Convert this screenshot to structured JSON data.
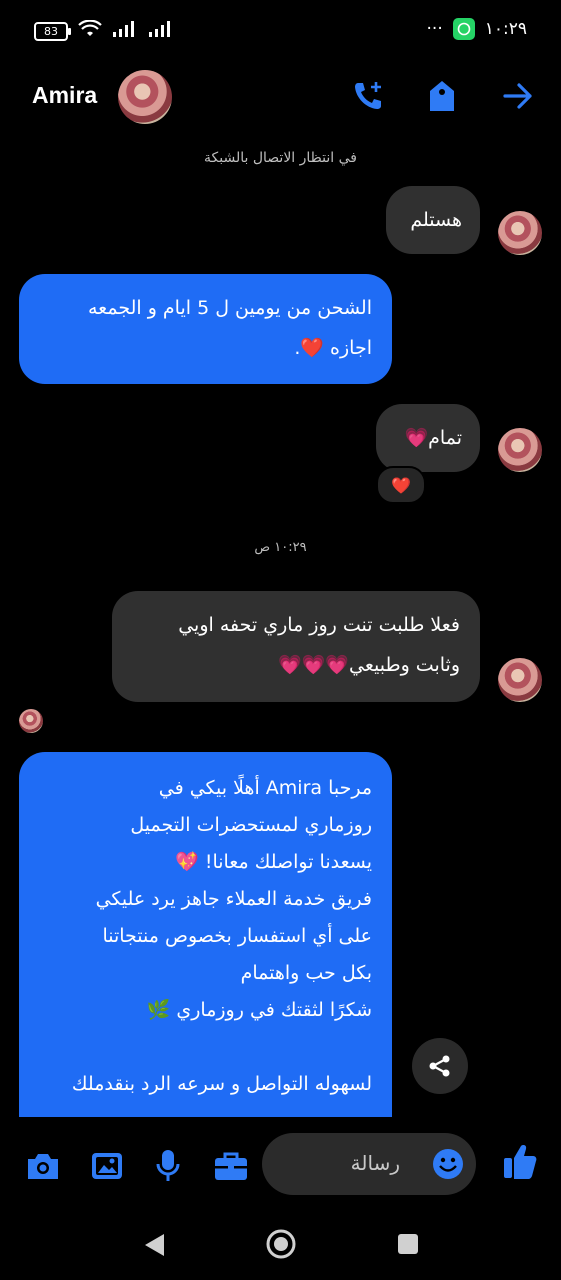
{
  "status_bar": {
    "battery": "83",
    "time": "١٠:٢٩",
    "more": "···"
  },
  "header": {
    "contact_name": "Amira",
    "icons": [
      "add-call-icon",
      "shop-bag-icon",
      "arrow-right-icon"
    ]
  },
  "network_status": "في انتظار الاتصال بالشبكة",
  "messages": [
    {
      "side": "incoming",
      "text": "هستلم"
    },
    {
      "side": "outgoing",
      "lines": [
        "الشحن من يومين ل 5 ايام و الجمعه",
        "اجازه ❤️."
      ]
    },
    {
      "side": "incoming",
      "text": "تمام💗",
      "reaction": "❤️"
    },
    {
      "side": "incoming",
      "lines": [
        "فعلا طلبت تنت روز ماري تحفه اويي",
        "وثابت وطبيعي💗💗💗"
      ]
    },
    {
      "side": "outgoing",
      "lines": [
        "مرحبا  Amira  أهلًا بيكي في",
        "روزماري لمستحضرات التجميل",
        "يسعدنا تواصلك معانا! 💖",
        "فريق خدمة العملاء جاهز يرد عليكي",
        "على أي استفسار بخصوص منتجاتنا",
        "بكل حب واهتمام",
        "شكرًا لثقتك في روزماري 🌿",
        "",
        "لسهوله التواصل و سرعه الرد بنقدملك"
      ]
    }
  ],
  "timestamp": "١٠:٢٩ ص",
  "composer": {
    "placeholder": "رسالة",
    "tools": [
      "camera-icon",
      "gallery-icon",
      "microphone-icon",
      "briefcase-icon"
    ]
  },
  "colors": {
    "accent": "#2f7bf5",
    "outgoing_bubble": "#1f6cf5",
    "incoming_bubble": "#303030",
    "background": "#000000"
  }
}
